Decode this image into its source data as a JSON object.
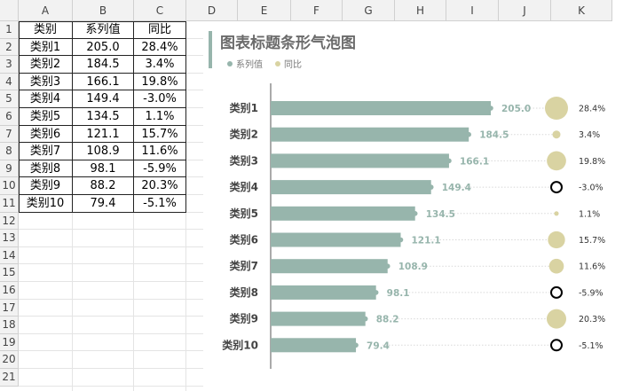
{
  "spreadsheet": {
    "columns": [
      "A",
      "B",
      "C",
      "D",
      "E",
      "F",
      "G",
      "H",
      "I",
      "J",
      "K"
    ],
    "rows": [
      "1",
      "2",
      "3",
      "4",
      "5",
      "6",
      "7",
      "8",
      "9",
      "10",
      "11",
      "12",
      "13",
      "14",
      "15",
      "16",
      "17",
      "18",
      "19",
      "20",
      "21"
    ],
    "table_headers": [
      "类别",
      "系列值",
      "同比"
    ],
    "table_rows": [
      [
        "类别1",
        "205.0",
        "28.4%"
      ],
      [
        "类别2",
        "184.5",
        "3.4%"
      ],
      [
        "类别3",
        "166.1",
        "19.8%"
      ],
      [
        "类别4",
        "149.4",
        "-3.0%"
      ],
      [
        "类别5",
        "134.5",
        "1.1%"
      ],
      [
        "类别6",
        "121.1",
        "15.7%"
      ],
      [
        "类别7",
        "108.9",
        "11.6%"
      ],
      [
        "类别8",
        "98.1",
        "-5.9%"
      ],
      [
        "类别9",
        "88.2",
        "20.3%"
      ],
      [
        "类别10",
        "79.4",
        "-5.1%"
      ]
    ]
  },
  "chart": {
    "title": "图表标题条形气泡图",
    "legend": [
      "系列值",
      "同比"
    ]
  },
  "colors": {
    "bar": "#97b5ac",
    "bubble": "#d9d3a2",
    "negative_outline": "#000000",
    "value_label": "#97b5ac",
    "category_label": "#444444"
  },
  "chart_data": {
    "type": "bar",
    "orientation": "horizontal",
    "title": "图表标题条形气泡图",
    "categories": [
      "类别1",
      "类别2",
      "类别3",
      "类别4",
      "类别5",
      "类别6",
      "类别7",
      "类别8",
      "类别9",
      "类别10"
    ],
    "series": [
      {
        "name": "系列值",
        "values": [
          205.0,
          184.5,
          166.1,
          149.4,
          134.5,
          121.1,
          108.9,
          98.1,
          88.2,
          79.4
        ],
        "labels": [
          "205.0",
          "184.5",
          "166.1",
          "149.4",
          "134.5",
          "121.1",
          "108.9",
          "98.1",
          "88.2",
          "79.4"
        ]
      },
      {
        "name": "同比",
        "type": "bubble",
        "values": [
          28.4,
          3.4,
          19.8,
          -3.0,
          1.1,
          15.7,
          11.6,
          -5.9,
          20.3,
          -5.1
        ],
        "labels": [
          "28.4%",
          "3.4%",
          "19.8%",
          "-3.0%",
          "1.1%",
          "15.7%",
          "11.6%",
          "-5.9%",
          "20.3%",
          "-5.1%"
        ]
      }
    ],
    "xlim": [
      0,
      230
    ],
    "grid": false,
    "legend_position": "top-left"
  }
}
